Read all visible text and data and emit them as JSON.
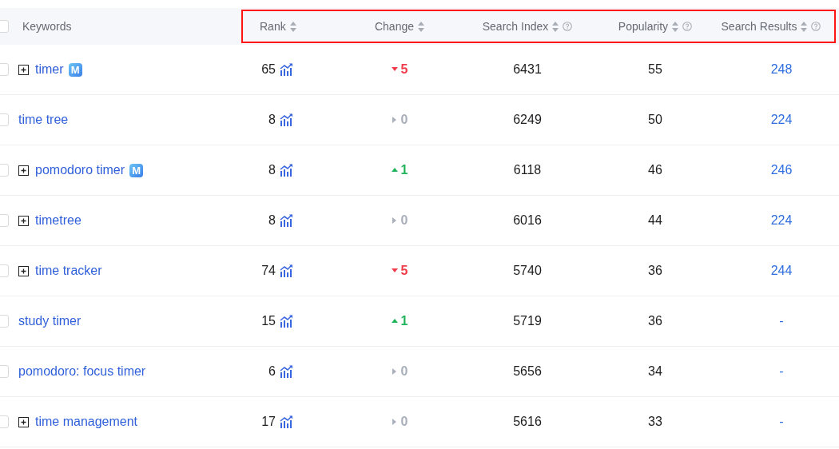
{
  "header": {
    "highlighted": true,
    "checked": false,
    "columns": [
      {
        "label": "Keywords",
        "sortable": false,
        "help": false
      },
      {
        "label": "Rank",
        "sortable": true,
        "help": false
      },
      {
        "label": "Change",
        "sortable": true,
        "help": false
      },
      {
        "label": "Search Index",
        "sortable": true,
        "help": true
      },
      {
        "label": "Popularity",
        "sortable": true,
        "help": true
      },
      {
        "label": "Search Results",
        "sortable": true,
        "help": true
      }
    ]
  },
  "rows": [
    {
      "keyword": "timer",
      "expandable": true,
      "badge": "M",
      "checked": false,
      "rank": "65",
      "kind": "down",
      "change": "5",
      "search_index": "6431",
      "popularity": "55",
      "search_results": "248"
    },
    {
      "keyword": "time tree",
      "expandable": false,
      "checked": false,
      "rank": "8",
      "kind": "none",
      "change": "0",
      "search_index": "6249",
      "popularity": "50",
      "search_results": "224"
    },
    {
      "keyword": "pomodoro timer",
      "expandable": true,
      "badge": "M",
      "checked": false,
      "rank": "8",
      "kind": "up",
      "change": "1",
      "search_index": "6118",
      "popularity": "46",
      "search_results": "246"
    },
    {
      "keyword": "timetree",
      "expandable": true,
      "checked": false,
      "rank": "8",
      "kind": "none",
      "change": "0",
      "search_index": "6016",
      "popularity": "44",
      "search_results": "224"
    },
    {
      "keyword": "time tracker",
      "expandable": true,
      "checked": false,
      "rank": "74",
      "kind": "down",
      "change": "5",
      "search_index": "5740",
      "popularity": "36",
      "search_results": "244"
    },
    {
      "keyword": "study timer",
      "expandable": false,
      "checked": false,
      "rank": "15",
      "kind": "up",
      "change": "1",
      "search_index": "5719",
      "popularity": "36",
      "search_results": "-"
    },
    {
      "keyword": "pomodoro: focus timer",
      "expandable": false,
      "checked": false,
      "rank": "6",
      "kind": "none",
      "change": "0",
      "search_index": "5656",
      "popularity": "34",
      "search_results": "-"
    },
    {
      "keyword": "time management",
      "expandable": true,
      "checked": false,
      "rank": "17",
      "kind": "none",
      "change": "0",
      "search_index": "5616",
      "popularity": "33",
      "search_results": "-"
    }
  ]
}
